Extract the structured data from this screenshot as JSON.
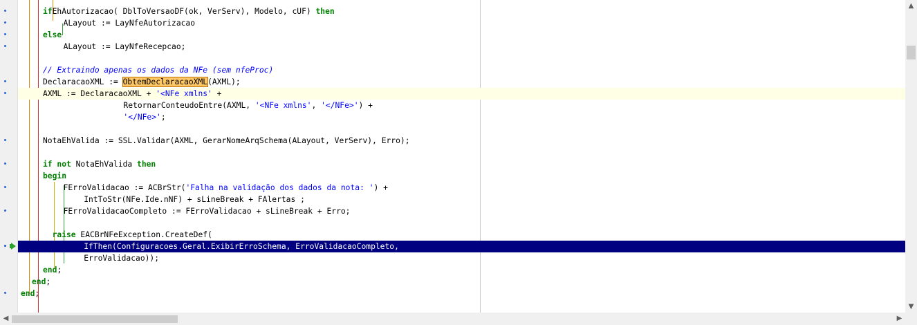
{
  "colors": {
    "keyword": "#008000",
    "string": "#0000ff",
    "comment": "#0000ff",
    "execution_line_bg": "#000080",
    "current_line_bg": "#ffffe6",
    "search_highlight": "#ffc864",
    "gutter_dot": "#2a64d8",
    "execution_arrow": "#2ea02e"
  },
  "icons": {
    "breakpoint_dot": "blue-dot",
    "execution_point": "green-arrow",
    "scroll_up": "▲",
    "scroll_down": "▼",
    "scroll_left": "◀",
    "scroll_right": "▶"
  },
  "editor": {
    "current_line": 8,
    "execution_line": 21,
    "lines": [
      {
        "segs": [
          [
            "kw",
            "if"
          ],
          [
            "",
            "EhAutorizacao( DblToVersaoDF(ok, VerServ), Modelo, cUF) "
          ],
          [
            "kw",
            "then"
          ]
        ]
      },
      {
        "segs": [
          [
            "",
            "  ALayout := LayNfeAutorizacao"
          ]
        ]
      },
      {
        "segs": [
          [
            "kw",
            "else"
          ]
        ]
      },
      {
        "segs": [
          [
            "",
            "  ALayout := LayNfeRecepcao;"
          ]
        ]
      },
      {
        "segs": []
      },
      {
        "segs": [
          [
            "cmt",
            "// Extraindo apenas os dados da NFe (sem nfeProc)"
          ]
        ]
      },
      {
        "segs": [
          [
            "",
            "DeclaracaoXML := "
          ],
          [
            "hl",
            "ObtemDeclaracaoXML"
          ],
          [
            "",
            "(AXML);"
          ]
        ]
      },
      {
        "segs": [
          [
            "",
            "AXML := DeclaracaoXML + "
          ],
          [
            "str",
            "'<NFe xmlns'"
          ],
          [
            "",
            " +"
          ]
        ]
      },
      {
        "segs": [
          [
            "",
            "        RetornarConteudoEntre(AXML, "
          ],
          [
            "str",
            "'<NFe xmlns'"
          ],
          [
            "",
            ", "
          ],
          [
            "str",
            "'</NFe>'"
          ],
          [
            "",
            ") +"
          ]
        ]
      },
      {
        "segs": [
          [
            "",
            "        "
          ],
          [
            "str",
            "'</NFe>'"
          ],
          [
            "",
            ";"
          ]
        ]
      },
      {
        "segs": []
      },
      {
        "segs": [
          [
            "",
            "NotaEhValida := SSL.Validar(AXML, GerarNomeArqSchema(ALayout, VerServ), Erro);"
          ]
        ]
      },
      {
        "segs": []
      },
      {
        "segs": [
          [
            "kw",
            "if not"
          ],
          [
            "",
            " NotaEhValida "
          ],
          [
            "kw",
            "then"
          ]
        ]
      },
      {
        "segs": [
          [
            "kw",
            "begin"
          ]
        ]
      },
      {
        "segs": [
          [
            "",
            "  FErroValidacao := ACBrStr("
          ],
          [
            "str",
            "'Falha na validação dos dados da nota: '"
          ],
          [
            "",
            ") +"
          ]
        ]
      },
      {
        "segs": [
          [
            "",
            "    IntToStr(NFe.Ide.nNF) + sLineBreak + FAlertas ;"
          ]
        ]
      },
      {
        "segs": [
          [
            "",
            "  FErroValidacaoCompleto := FErroValidacao + sLineBreak + Erro;"
          ]
        ]
      },
      {
        "segs": []
      },
      {
        "segs": [
          [
            "kw",
            "  raise"
          ],
          [
            "",
            " EACBrNFeException.CreateDef("
          ]
        ]
      },
      {
        "segs": [
          [
            "",
            "    IfThen(Configuracoes.Geral.ExibirErroSchema, ErroValidacaoCompleto,"
          ]
        ]
      },
      {
        "segs": [
          [
            "",
            "    ErroValidacao));"
          ]
        ]
      },
      {
        "segs": [
          [
            "kw",
            "end"
          ],
          [
            "",
            ";"
          ]
        ]
      },
      {
        "segs": [
          [
            "kw",
            "end"
          ],
          [
            "",
            ";"
          ]
        ]
      },
      {
        "segs": [
          [
            "kw",
            "end"
          ],
          [
            "",
            ";"
          ]
        ]
      }
    ]
  }
}
